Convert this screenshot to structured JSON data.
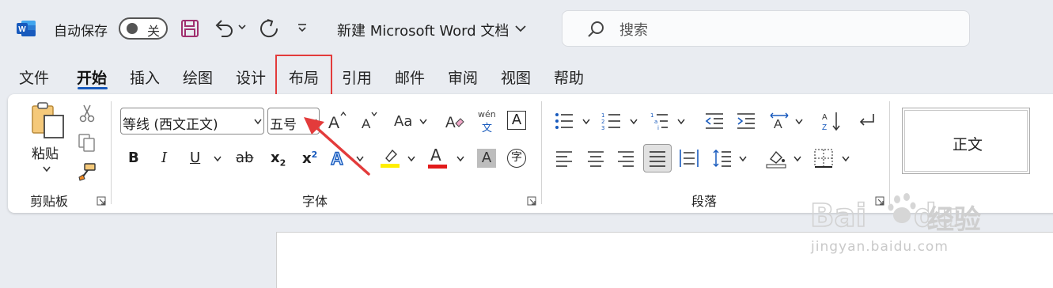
{
  "app": {
    "autosave_label": "自动保存",
    "autosave_state": "关",
    "doc_title": "新建 Microsoft Word 文档",
    "search_placeholder": "搜索"
  },
  "tabs": [
    {
      "label": "文件"
    },
    {
      "label": "开始",
      "active": true
    },
    {
      "label": "插入"
    },
    {
      "label": "绘图"
    },
    {
      "label": "设计"
    },
    {
      "label": "布局",
      "highlighted": true
    },
    {
      "label": "引用"
    },
    {
      "label": "邮件"
    },
    {
      "label": "审阅"
    },
    {
      "label": "视图"
    },
    {
      "label": "帮助"
    }
  ],
  "ribbon": {
    "clipboard": {
      "paste_label": "粘贴",
      "group_label": "剪贴板"
    },
    "font": {
      "font_name": "等线 (西文正文)",
      "font_size": "五号",
      "group_label": "字体",
      "bold": "B",
      "italic": "I",
      "underline": "U",
      "strike": "ab",
      "subscript": "x",
      "superscript": "x",
      "change_case": "Aa",
      "phonetic_top": "wén",
      "phonetic_bottom": "文",
      "enclose": "字",
      "char_border": "A",
      "font_color": "A",
      "char_shading": "A"
    },
    "paragraph": {
      "group_label": "段落"
    },
    "styles": {
      "items": [
        "正文"
      ]
    }
  },
  "watermark": {
    "brand_cn": "经验",
    "url": "jingyan.baidu.com"
  },
  "colors": {
    "accent": "#185abd",
    "highlight_box": "#e33b3b",
    "word_blue": "#185abd",
    "save_purple": "#a0306f",
    "highlighter_yellow": "#ffee00",
    "font_red": "#e21b1b"
  }
}
